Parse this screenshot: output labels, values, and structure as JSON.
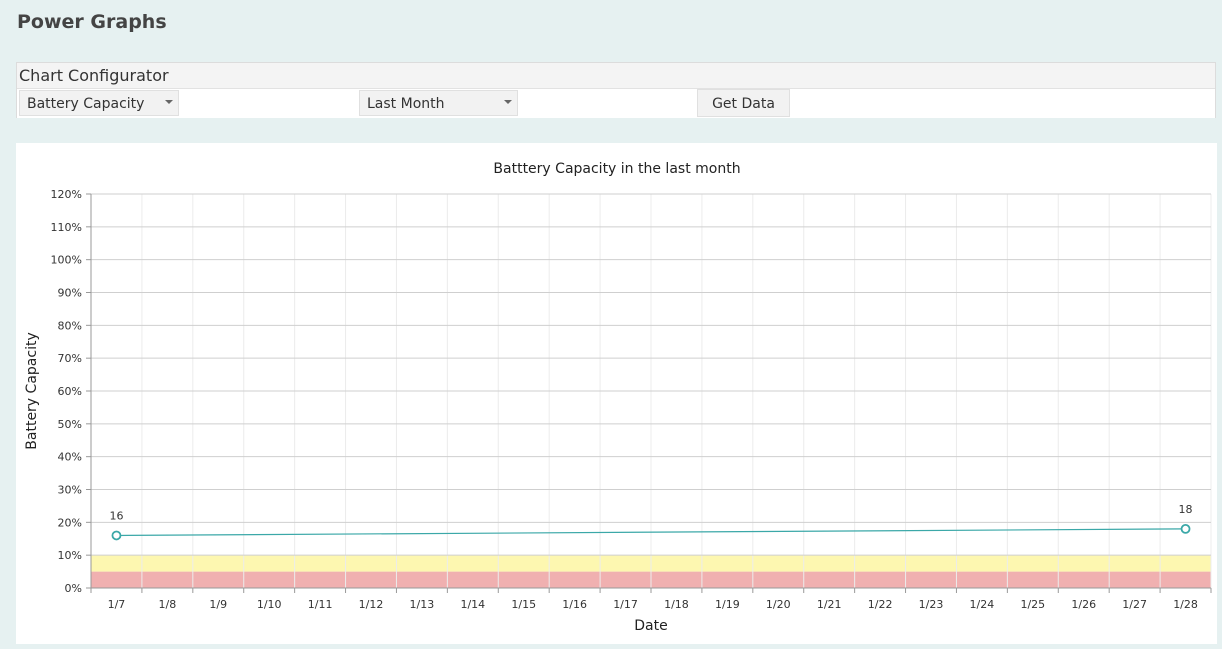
{
  "page": {
    "title": "Power Graphs"
  },
  "configurator": {
    "title": "Chart Configurator",
    "metric_select": {
      "value": "Battery Capacity"
    },
    "range_select": {
      "value": "Last Month"
    },
    "get_data_label": "Get Data"
  },
  "chart_data": {
    "type": "line",
    "title": "Batttery Capacity in the last month",
    "xlabel": "Date",
    "ylabel": "Battery Capacity",
    "categories": [
      "1/7",
      "1/8",
      "1/9",
      "1/10",
      "1/11",
      "1/12",
      "1/13",
      "1/14",
      "1/15",
      "1/16",
      "1/17",
      "1/18",
      "1/19",
      "1/20",
      "1/21",
      "1/22",
      "1/23",
      "1/24",
      "1/25",
      "1/26",
      "1/27",
      "1/28"
    ],
    "y_ticks": [
      "0%",
      "10%",
      "20%",
      "30%",
      "40%",
      "50%",
      "60%",
      "70%",
      "80%",
      "90%",
      "100%",
      "110%",
      "120%"
    ],
    "ylim": [
      0,
      120
    ],
    "grid": true,
    "series": [
      {
        "points": [
          {
            "x": "1/7",
            "y": 16,
            "label": "16"
          },
          {
            "x": "1/28",
            "y": 18,
            "label": "18"
          }
        ]
      }
    ],
    "bands": [
      {
        "from": 0,
        "to": 5,
        "color": "#f0b0b0"
      },
      {
        "from": 5,
        "to": 10,
        "color": "#fdf7b0"
      }
    ],
    "line_color": "#3ba8a8"
  }
}
